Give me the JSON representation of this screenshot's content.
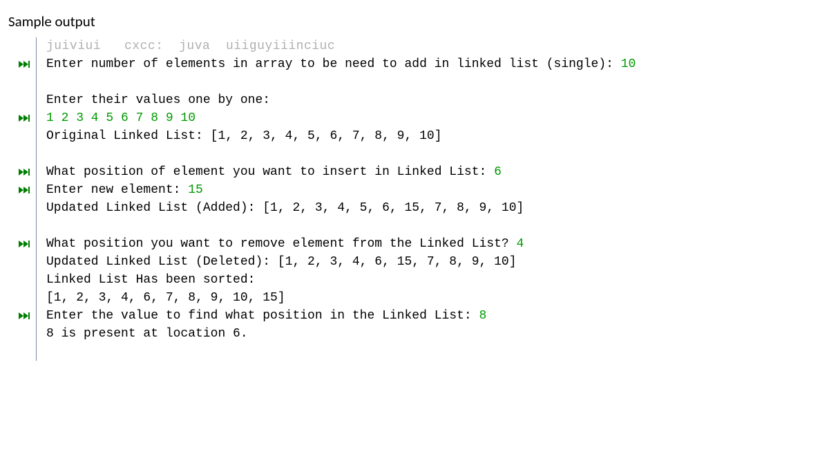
{
  "heading": "Sample output",
  "faded_top": "juiviui   cxcc:  juva  uiiguyiiinciuc",
  "lines": [
    {
      "m": true,
      "segs": [
        {
          "t": "Enter number of elements in array to be need to add in linked list (single): "
        },
        {
          "t": "10",
          "u": true
        }
      ]
    },
    {
      "m": false,
      "segs": [
        {
          "t": ""
        }
      ]
    },
    {
      "m": false,
      "segs": [
        {
          "t": "Enter their values one by one:"
        }
      ]
    },
    {
      "m": true,
      "segs": [
        {
          "t": "1 2 3 4 5 6 7 8 9 10",
          "u": true
        }
      ]
    },
    {
      "m": false,
      "segs": [
        {
          "t": "Original Linked List: [1, 2, 3, 4, 5, 6, 7, 8, 9, 10]"
        }
      ]
    },
    {
      "m": false,
      "segs": [
        {
          "t": ""
        }
      ]
    },
    {
      "m": true,
      "segs": [
        {
          "t": "What position of element you want to insert in Linked List: "
        },
        {
          "t": "6",
          "u": true
        }
      ]
    },
    {
      "m": true,
      "segs": [
        {
          "t": "Enter new element: "
        },
        {
          "t": "15",
          "u": true
        }
      ]
    },
    {
      "m": false,
      "segs": [
        {
          "t": "Updated Linked List (Added): [1, 2, 3, 4, 5, 6, 15, 7, 8, 9, 10]"
        }
      ]
    },
    {
      "m": false,
      "segs": [
        {
          "t": ""
        }
      ]
    },
    {
      "m": true,
      "segs": [
        {
          "t": "What position you want to remove element from the Linked List? "
        },
        {
          "t": "4",
          "u": true
        }
      ]
    },
    {
      "m": false,
      "segs": [
        {
          "t": "Updated Linked List (Deleted): [1, 2, 3, 4, 6, 15, 7, 8, 9, 10]"
        }
      ]
    },
    {
      "m": false,
      "segs": [
        {
          "t": "Linked List Has been sorted:"
        }
      ]
    },
    {
      "m": false,
      "segs": [
        {
          "t": "[1, 2, 3, 4, 6, 7, 8, 9, 10, 15]"
        }
      ]
    },
    {
      "m": true,
      "segs": [
        {
          "t": "Enter the value to find what position in the Linked List: "
        },
        {
          "t": "8",
          "u": true
        }
      ]
    },
    {
      "m": false,
      "segs": [
        {
          "t": "8 is present at location 6."
        }
      ]
    },
    {
      "m": false,
      "segs": [
        {
          "t": ""
        }
      ]
    }
  ]
}
